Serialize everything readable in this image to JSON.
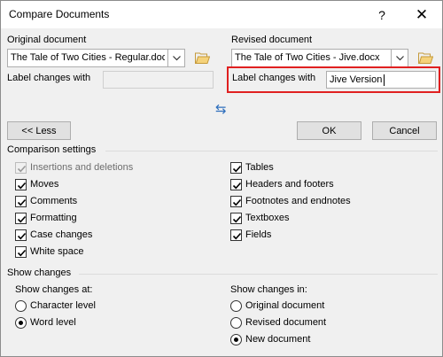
{
  "window": {
    "title": "Compare Documents",
    "help_glyph": "?",
    "close_glyph": "✕"
  },
  "original": {
    "header": "Original document",
    "file": "The Tale of Two Cities - Regular.docx",
    "label_caption": "Label changes with",
    "label_value": ""
  },
  "revised": {
    "header": "Revised document",
    "file": "The Tale of Two Cities - Jive.docx",
    "label_caption": "Label changes with",
    "label_value": "Jive Version"
  },
  "swap_glyph": "⇆",
  "buttons": {
    "less": "<< Less",
    "ok": "OK",
    "cancel": "Cancel"
  },
  "comparison": {
    "header": "Comparison settings",
    "left": [
      {
        "label": "Insertions and deletions",
        "checked": true,
        "disabled": true
      },
      {
        "label": "Moves",
        "checked": true,
        "disabled": false
      },
      {
        "label": "Comments",
        "checked": true,
        "disabled": false
      },
      {
        "label": "Formatting",
        "checked": true,
        "disabled": false
      },
      {
        "label": "Case changes",
        "checked": true,
        "disabled": false
      },
      {
        "label": "White space",
        "checked": true,
        "disabled": false
      }
    ],
    "right": [
      {
        "label": "Tables",
        "checked": true,
        "disabled": false
      },
      {
        "label": "Headers and footers",
        "checked": true,
        "disabled": false
      },
      {
        "label": "Footnotes and endnotes",
        "checked": true,
        "disabled": false
      },
      {
        "label": "Textboxes",
        "checked": true,
        "disabled": false
      },
      {
        "label": "Fields",
        "checked": true,
        "disabled": false
      }
    ]
  },
  "show_changes": {
    "header": "Show changes",
    "at_label": "Show changes at:",
    "at_options": [
      {
        "label": "Character level",
        "selected": false
      },
      {
        "label": "Word level",
        "selected": true
      }
    ],
    "in_label": "Show changes in:",
    "in_options": [
      {
        "label": "Original document",
        "selected": false
      },
      {
        "label": "Revised document",
        "selected": false
      },
      {
        "label": "New document",
        "selected": true
      }
    ]
  },
  "colors": {
    "highlight": "#e02020",
    "dialog_bg": "#f0f0f0"
  }
}
